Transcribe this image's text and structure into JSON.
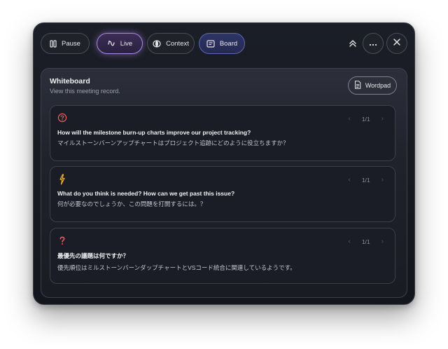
{
  "toolbar": {
    "pause_label": "Pause",
    "live_label": "Live",
    "context_label": "Context",
    "board_label": "Board"
  },
  "panel": {
    "title": "Whiteboard",
    "subtitle": "View this meeting record.",
    "wordpad_label": "Wordpad"
  },
  "cards": [
    {
      "icon": "question-circle-icon",
      "icon_color": "#e2595f",
      "page": "1/1",
      "question": "How will the milestone burn-up charts improve our project tracking?",
      "answer": "マイルストーンバーンアップチャートはプロジェクト追跡にどのように役立ちますか？"
    },
    {
      "icon": "lightning-icon",
      "icon_color": "#f2b52e",
      "page": "1/1",
      "question": "What do you think is needed? How can we get past this issue?",
      "answer": "何が必要なのでしょうか、この問題を打開するには。？"
    },
    {
      "icon": "question-mark-icon",
      "icon_color": "#e2595f",
      "page": "1/1",
      "question": "最優先の議題は何ですか？",
      "answer": "優先順位はミルストーンバーンダップチャートとVSコード統合に関連しているようです。"
    }
  ],
  "colors": {
    "live_accent": "#a98be0",
    "board_accent": "#5e68b8"
  }
}
